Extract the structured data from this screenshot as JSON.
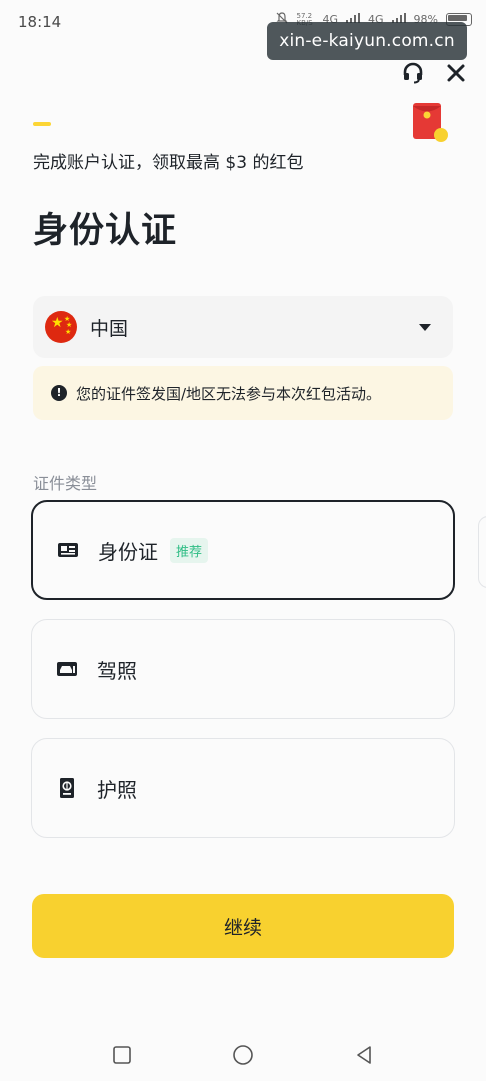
{
  "status_bar": {
    "time": "18:14",
    "network_speed": "57.2 KB/S",
    "network_1": "4G",
    "network_2": "4G",
    "battery": "98%"
  },
  "watermark": "xin-e-kaiyun.com.cn",
  "promo_text": "完成账户认证，领取最高 $3 的红包",
  "page_title": "身份认证",
  "country": {
    "name": "中国"
  },
  "notice": {
    "text": "您的证件签发国/地区无法参与本次红包活动。"
  },
  "id_type_section": {
    "label": "证件类型",
    "options": [
      {
        "label": "身份证",
        "badge": "推荐",
        "selected": true
      },
      {
        "label": "驾照"
      },
      {
        "label": "护照"
      }
    ]
  },
  "continue_label": "继续",
  "progress": {
    "step": 1
  },
  "colors": {
    "accent": "#F8D12F",
    "badge_green": "#2EBD85",
    "notice_bg": "#FCF6E3",
    "text": "#1E2329"
  },
  "icons": {
    "headset": "headset-icon",
    "close": "close-icon",
    "envelope": "red-envelope-icon",
    "id_card": "id-card-icon",
    "driver_license": "driver-license-icon",
    "passport": "passport-icon",
    "warning": "exclamation-icon"
  }
}
